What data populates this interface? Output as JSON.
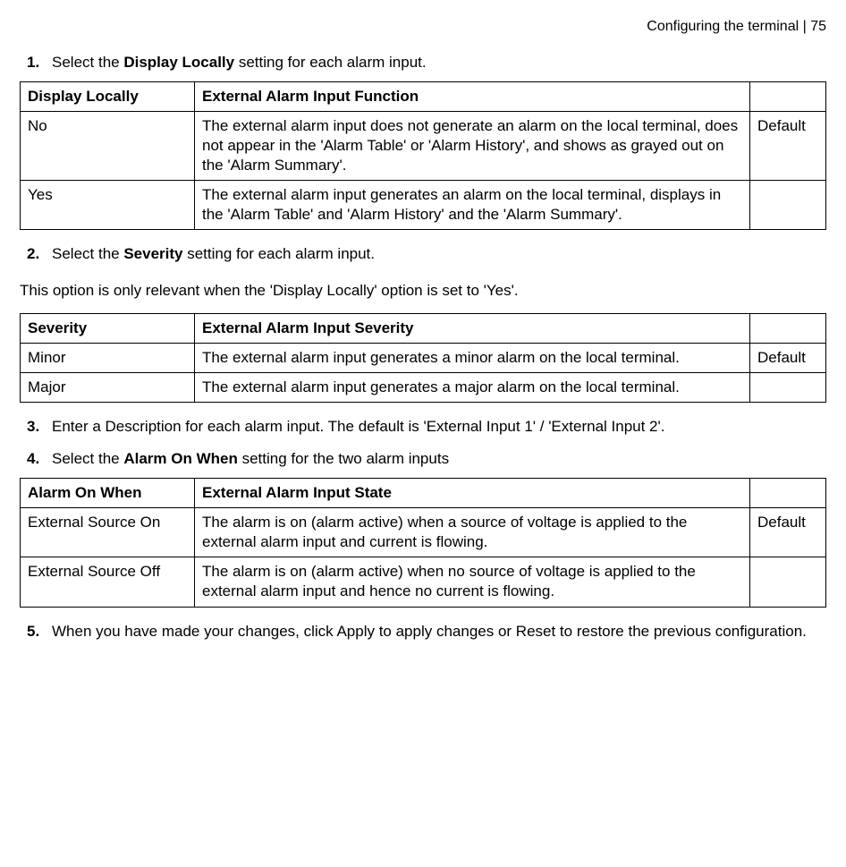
{
  "header": {
    "text": "Configuring the terminal  |  75"
  },
  "steps": {
    "s1": {
      "num": "1.",
      "prefix": "Select the ",
      "bold": "Display Locally",
      "suffix": " setting for each alarm input."
    },
    "s2": {
      "num": "2.",
      "prefix": "Select the ",
      "bold": "Severity",
      "suffix": " setting for each alarm input."
    },
    "s3": {
      "num": "3.",
      "text": "Enter a Description for each alarm input. The default is 'External Input 1' / 'External Input 2'."
    },
    "s4": {
      "num": "4.",
      "prefix": "Select the ",
      "bold": "Alarm On When",
      "suffix": " setting for the two alarm inputs"
    },
    "s5": {
      "num": "5.",
      "text": "When you have made your changes, click Apply to apply changes or Reset to restore the previous configuration."
    }
  },
  "note": "This option is only relevant when the 'Display Locally' option is set to 'Yes'.",
  "table1": {
    "h1": "Display Locally",
    "h2": "External Alarm Input Function",
    "r1c1": "No",
    "r1c2": "The external alarm input does not generate an alarm on the local terminal, does not appear in the 'Alarm Table' or 'Alarm History', and shows as grayed out on the 'Alarm Summary'.",
    "r1c3": "Default",
    "r2c1": "Yes",
    "r2c2": "The external alarm input generates an alarm on the local terminal, displays in the 'Alarm Table' and 'Alarm History' and the 'Alarm Summary'.",
    "r2c3": ""
  },
  "table2": {
    "h1": "Severity",
    "h2": "External Alarm Input Severity",
    "r1c1": "Minor",
    "r1c2": "The external alarm input generates a minor alarm on the local terminal.",
    "r1c3": "Default",
    "r2c1": "Major",
    "r2c2": "The external alarm input generates a major alarm on the local terminal.",
    "r2c3": ""
  },
  "table3": {
    "h1": "Alarm On When",
    "h2": "External Alarm Input State",
    "r1c1": "External Source On",
    "r1c2": "The alarm is on (alarm active) when a source of voltage is applied to the external alarm input and current is flowing.",
    "r1c3": "Default",
    "r2c1": "External Source Off",
    "r2c2": "The alarm is on (alarm active) when no source of voltage is applied to the external alarm input and hence no current is flowing.",
    "r2c3": ""
  }
}
